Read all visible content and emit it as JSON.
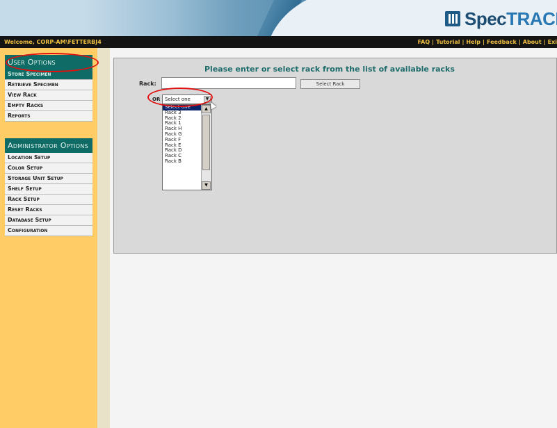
{
  "brand": {
    "logo_spec": "Spec",
    "logo_track": "TRACK"
  },
  "topbar": {
    "welcome": "Welcome, CORP-AM\\FETTERBJ4",
    "links": [
      "FAQ",
      "Tutorial",
      "Help",
      "Feedback",
      "About",
      "Exi"
    ]
  },
  "sidebar": {
    "user_options": {
      "header": "User Options",
      "items": [
        "Store Specimen",
        "Retrieve Specimen",
        "View Rack",
        "Empty Racks",
        "Reports"
      ]
    },
    "admin_options": {
      "header": "Administrator Options",
      "items": [
        "Location Setup",
        "Color Setup",
        "Storage Unit Setup",
        "Shelf Setup",
        "Rack Setup",
        "Reset Racks",
        "Database Setup",
        "Configuration"
      ]
    }
  },
  "main": {
    "title": "Please enter or select rack from the list of available racks",
    "rack_label": "Rack:",
    "rack_value": "",
    "select_button": "Select Rack",
    "or_label": "OR",
    "select_value": "Select one",
    "dropdown_options": [
      "Select one",
      "Rack 3",
      "Rack 2",
      "Rack 1",
      "Rack H",
      "Rack G",
      "Rack F",
      "Rack E",
      "Rack D",
      "Rack C",
      "Rack B"
    ]
  },
  "colors": {
    "accent": "#0f6b66",
    "sidebar": "#ffcc66",
    "navbar": "#141414",
    "annotation": "#e01010"
  }
}
